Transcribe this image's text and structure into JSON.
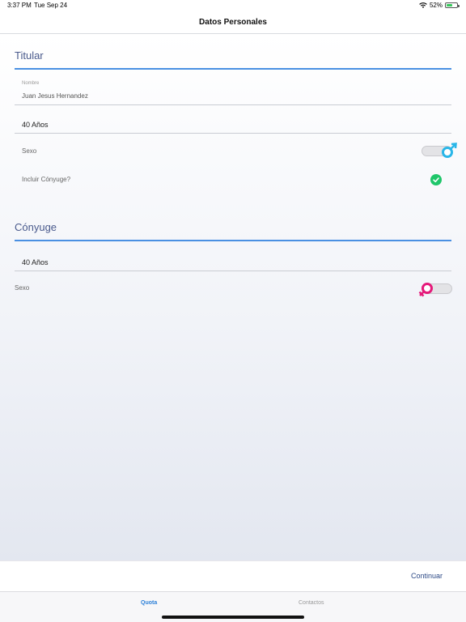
{
  "status_bar": {
    "time": "3:37 PM",
    "date": "Tue Sep 24",
    "battery": "52%",
    "icons": [
      "wifi-icon",
      "battery-icon"
    ]
  },
  "nav": {
    "title": "Datos Personales"
  },
  "titular": {
    "section_title": "Titular",
    "name_label": "Nombre",
    "name_value": "Juan Jesus Hernandez",
    "age_value": "40 Años",
    "sex_label": "Sexo",
    "sex_icon": "male-icon",
    "include_spouse_label": "Incluir Cónyuge?",
    "include_spouse_icon": "check-icon"
  },
  "conyuge": {
    "section_title": "Cónyuge",
    "age_value": "40 Años",
    "sex_label": "Sexo",
    "sex_icon": "female-icon"
  },
  "actions": {
    "continue_label": "Continuar"
  },
  "tabs": [
    {
      "label": "Quota",
      "active": true
    },
    {
      "label": "Contactos",
      "active": false
    }
  ],
  "colors": {
    "accent": "#4a90e2",
    "male": "#29b6e8",
    "female": "#e5197a",
    "check": "#1fc66a",
    "tab_active": "#2b7fd8"
  }
}
